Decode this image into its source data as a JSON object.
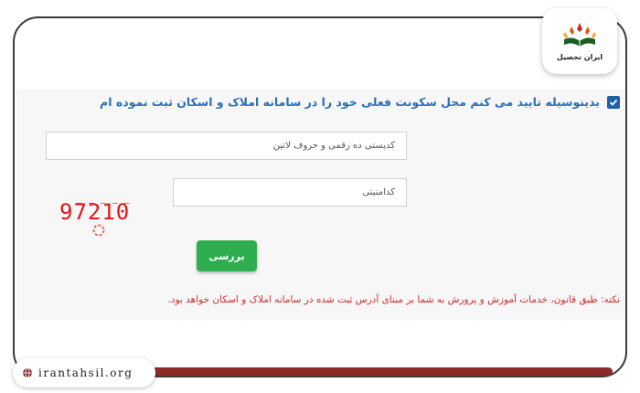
{
  "logo": {
    "text": "ایران تحصیل"
  },
  "form": {
    "confirm_label": "بدینوسیله تایید می کنم محل سکونت فعلی خود را در سامانه املاک و اسکان ثبت نموده ام",
    "postal_placeholder": "کدپستی ده رقمی و حروف لاتین",
    "captcha_placeholder": "کدامنیتی",
    "captcha_code": "97210",
    "captcha_marks": "_ _ _ _ _",
    "submit_label": "بررسی",
    "note": "نکته: طبق قانون، خدمات آموزش و پرورش به شما بر مبنای آدرس ثبت شده در سامانه املاک و اسکان خواهد بود."
  },
  "footer": {
    "site": "irantahsil.org"
  },
  "colors": {
    "accent": "#2a6fb8",
    "button": "#2fae4f",
    "note": "#d12a2a",
    "bar": "#8e2a2a"
  }
}
